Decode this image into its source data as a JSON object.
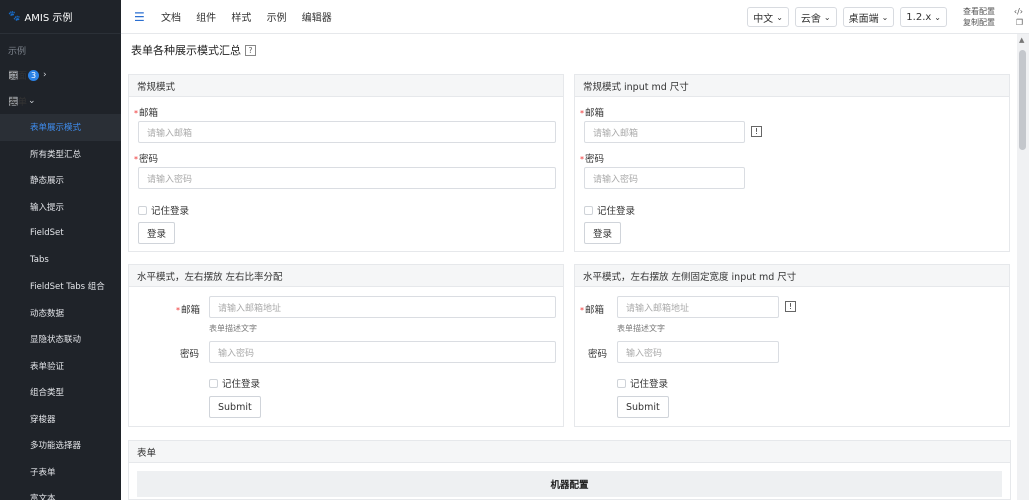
{
  "brand": {
    "title": "AMIS 示例"
  },
  "sidebar": {
    "section": "示例",
    "top_items": [
      {
        "label": "页面",
        "badge": "3"
      },
      {
        "label": "表单"
      }
    ],
    "sub_items": [
      "表单展示模式",
      "所有类型汇总",
      "静态展示",
      "输入提示",
      "FieldSet",
      "Tabs",
      "FieldSet Tabs 组合",
      "动态数据",
      "显隐状态联动",
      "表单验证",
      "组合类型",
      "穿梭器",
      "多功能选择器",
      "子表单",
      "富文本"
    ]
  },
  "header": {
    "nav": [
      "文档",
      "组件",
      "样式",
      "示例",
      "编辑器"
    ],
    "dropdowns": [
      "中文",
      "云舍",
      "桌面端",
      "1.2.x"
    ],
    "view_config": "查看配置",
    "copy_config": "复制配置"
  },
  "page": {
    "title": "表单各种展示模式汇总",
    "help": "?"
  },
  "panels": {
    "normal": {
      "title": "常规模式",
      "email_label": "邮箱",
      "email_placeholder": "请输入邮箱",
      "password_label": "密码",
      "password_placeholder": "请输入密码",
      "remember": "记住登录",
      "submit": "登录"
    },
    "normal_md": {
      "title": "常规模式 input md 尺寸",
      "email_label": "邮箱",
      "email_placeholder": "请输入邮箱",
      "password_label": "密码",
      "password_placeholder": "请输入密码",
      "remember": "记住登录",
      "submit": "登录",
      "hint": "!"
    },
    "horizontal": {
      "title": "水平模式，左右摆放 左右比率分配",
      "email_label": "邮箱",
      "email_placeholder": "请输入邮箱地址",
      "email_desc": "表单描述文字",
      "password_label": "密码",
      "password_placeholder": "输入密码",
      "remember": "记住登录",
      "submit": "Submit"
    },
    "horizontal_fixed": {
      "title": "水平模式，左右摆放 左侧固定宽度 input md 尺寸",
      "email_label": "邮箱",
      "email_placeholder": "请输入邮箱地址",
      "email_desc": "表单描述文字",
      "password_label": "密码",
      "password_placeholder": "输入密码",
      "remember": "记住登录",
      "submit": "Submit",
      "hint": "!"
    },
    "table": {
      "title": "表单",
      "column_group": "机器配置"
    }
  }
}
